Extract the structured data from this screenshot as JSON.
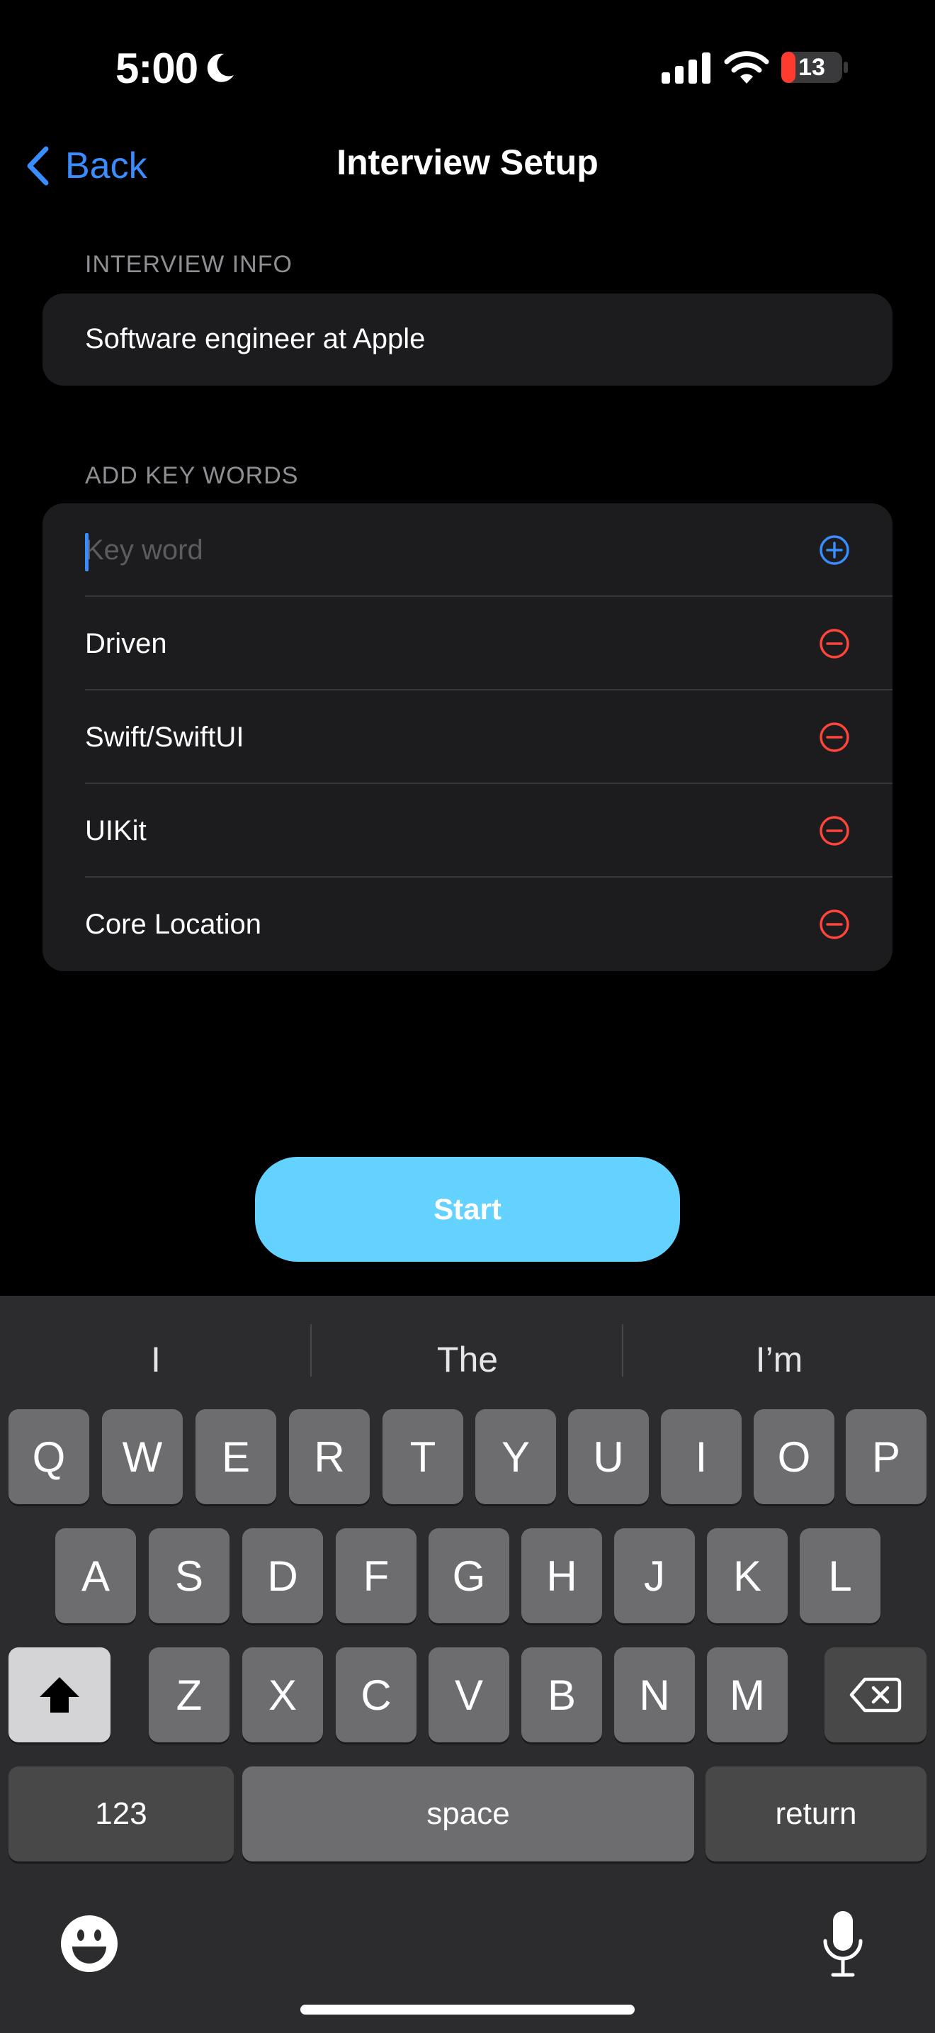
{
  "status_bar": {
    "time": "5:00",
    "battery": "13"
  },
  "nav": {
    "back_label": "Back",
    "title": "Interview Setup"
  },
  "interview_info": {
    "section_label": "INTERVIEW INFO",
    "value": "Software engineer at Apple"
  },
  "keywords": {
    "section_label": "ADD KEY WORDS",
    "placeholder": "Key word",
    "items": [
      "Driven",
      "Swift/SwiftUI",
      "UIKit",
      "Core Location"
    ]
  },
  "start_label": "Start",
  "keyboard": {
    "suggestions": [
      "I",
      "The",
      "I’m"
    ],
    "row1": [
      "Q",
      "W",
      "E",
      "R",
      "T",
      "Y",
      "U",
      "I",
      "O",
      "P"
    ],
    "row2": [
      "A",
      "S",
      "D",
      "F",
      "G",
      "H",
      "J",
      "K",
      "L"
    ],
    "row3": [
      "Z",
      "X",
      "C",
      "V",
      "B",
      "N",
      "M"
    ],
    "numbers_label": "123",
    "space_label": "space",
    "return_label": "return"
  },
  "colors": {
    "accent": "#3a8dff",
    "remove": "#ff453a",
    "start": "#64d2ff",
    "battery_low": "#ff3b30"
  }
}
